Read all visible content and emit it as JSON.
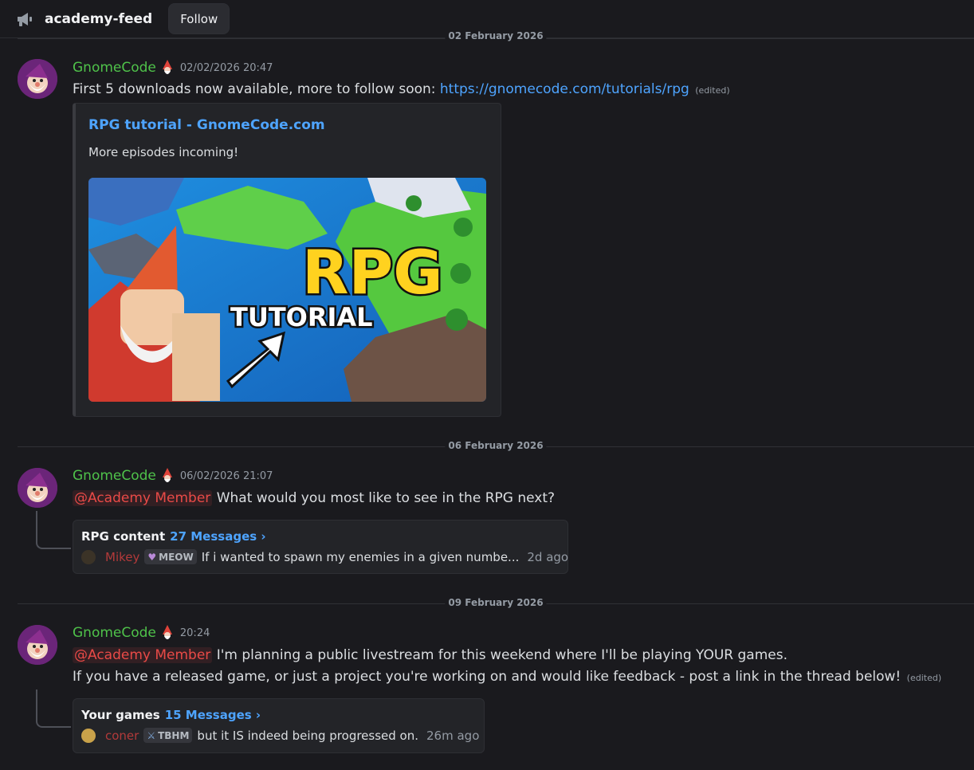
{
  "header": {
    "channel_icon": "announcement-megaphone-icon",
    "channel_name": "academy-feed",
    "follow_label": "Follow"
  },
  "dividers": [
    {
      "label": "02 February 2026"
    },
    {
      "label": "06 February 2026"
    },
    {
      "label": "09 February 2026"
    }
  ],
  "messages": [
    {
      "author": "GnomeCode",
      "author_color": "#4fc24a",
      "timestamp": "02/02/2026 20:47",
      "text": "First 5 downloads now available, more to follow soon: ",
      "link": "https://gnomecode.com/tutorials/rpg",
      "edited": "(edited)",
      "embed": {
        "title": "RPG tutorial - GnomeCode.com",
        "description": "More episodes incoming!",
        "image_title_line1": "RPG",
        "image_title_line2": "TUTORIAL"
      }
    },
    {
      "author": "GnomeCode",
      "timestamp": "06/02/2026 21:07",
      "mention": "@Academy Member",
      "text": " What would you most like to see in the RPG next?",
      "thread": {
        "title": "RPG content",
        "count": "27 Messages ›",
        "preview_author": "Mikey",
        "preview_tag": "MEOW",
        "preview_text": "If i wanted to spawn my enemies in a given numbe...",
        "preview_time": "2d ago"
      }
    },
    {
      "author": "GnomeCode",
      "timestamp": "20:24",
      "mention": "@Academy Member",
      "text": " I'm planning a public livestream for this weekend where I'll be playing YOUR games.",
      "text2": "If you have a released game, or just a project you're working on and would like feedback - post a link in the thread below!",
      "edited": "(edited)",
      "thread": {
        "title": "Your games",
        "count": "15 Messages ›",
        "preview_author": "coner",
        "preview_tag": "TBHM",
        "preview_text": "but it IS indeed being progressed on.",
        "preview_time": "26m ago"
      }
    }
  ]
}
